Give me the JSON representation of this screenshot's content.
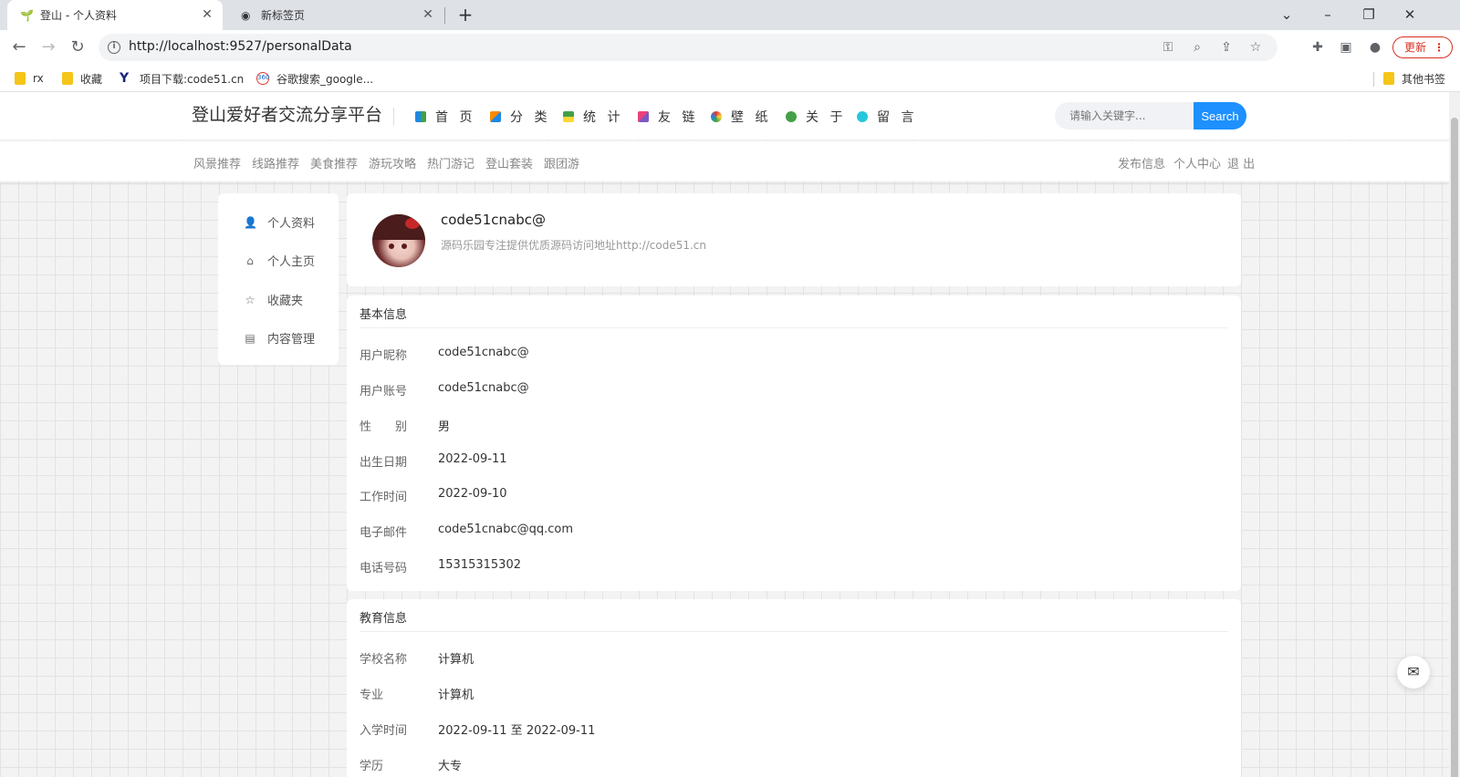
{
  "browser": {
    "tabs": [
      {
        "title": "登山 - 个人资料",
        "icon": "site-icon"
      },
      {
        "title": "新标签页",
        "icon": "globe-icon"
      }
    ],
    "url": "http://localhost:9527/personalData",
    "update_label": "更新",
    "bookmarks": [
      "rx",
      "收藏",
      "项目下载:code51.cn",
      "谷歌搜索_google..."
    ],
    "other_bookmarks": "其他书签"
  },
  "site": {
    "title": "登山爱好者交流分享平台",
    "nav": [
      "首 页",
      "分 类",
      "统 计",
      "友 链",
      "壁 纸",
      "关 于",
      "留 言"
    ],
    "search_placeholder": "请输入关键字...",
    "search_button": "Search",
    "subnav": [
      "风景推荐",
      "线路推荐",
      "美食推荐",
      "游玩攻略",
      "热门游记",
      "登山套装",
      "跟团游"
    ],
    "user_links": [
      "发布信息",
      "个人中心",
      "退 出"
    ]
  },
  "side_menu": [
    "个人资料",
    "个人主页",
    "收藏夹",
    "内容管理"
  ],
  "profile": {
    "name": "code51cnabc@",
    "description": "源码乐园专注提供优质源码访问地址http://code51.cn"
  },
  "basic_info": {
    "title": "基本信息",
    "fields": [
      {
        "label": "用户昵称",
        "value": "code51cnabc@"
      },
      {
        "label": "用户账号",
        "value": "code51cnabc@"
      },
      {
        "label": "性　　别",
        "value": "男"
      },
      {
        "label": "出生日期",
        "value": "2022-09-11"
      },
      {
        "label": "工作时间",
        "value": "2022-09-10"
      },
      {
        "label": "电子邮件",
        "value": "code51cnabc@qq.com"
      },
      {
        "label": "电话号码",
        "value": "15315315302"
      }
    ]
  },
  "education": {
    "title": "教育信息",
    "fields": [
      {
        "label": "学校名称",
        "value": "计算机"
      },
      {
        "label": "专业",
        "value": "计算机"
      },
      {
        "label": "入学时间",
        "value": "2022-09-11 至 2022-09-11"
      },
      {
        "label": "学历",
        "value": "大专"
      }
    ]
  },
  "colors": {
    "accent": "#1e90ff",
    "update_red": "#d93025"
  }
}
